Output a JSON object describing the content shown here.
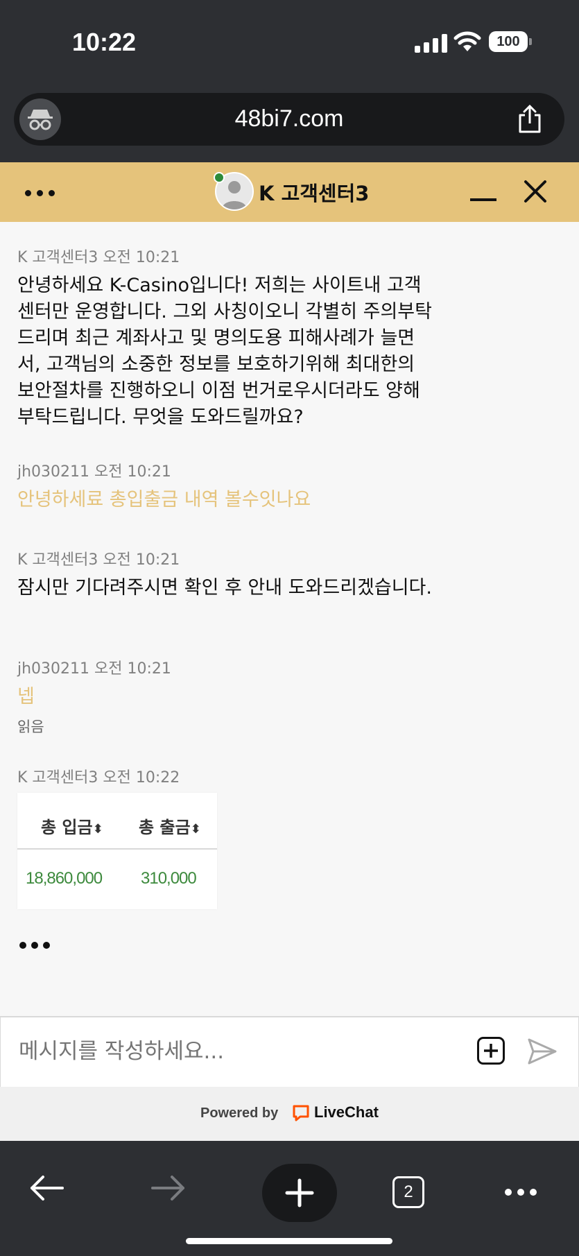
{
  "status_bar": {
    "time": "10:22",
    "battery": "100"
  },
  "browser": {
    "url": "48bi7.com",
    "tab_count": "2"
  },
  "chat_header": {
    "agent_name": "K 고객센터3"
  },
  "messages": [
    {
      "sender": "K 고객센터3",
      "time": "오전 10:21",
      "text": "안녕하세요 K-Casino입니다! 저희는 사이트내 고객센터만 운영합니다. 그외 사칭이오니 각별히 주의부탁드리며 최근 계좌사고 및 명의도용 피해사례가 늘면서, 고객님의 소중한 정보를 보호하기위해 최대한의 보안절차를 진행하오니 이점 번거로우시더라도 양해부탁드립니다. 무엇을 도와드릴까요?"
    },
    {
      "sender": "jh030211",
      "time": "오전 10:21",
      "text": "안녕하세료 총입출금 내역 볼수잇나요"
    },
    {
      "sender": "K 고객센터3",
      "time": "오전 10:21",
      "text": "잠시만 기다려주시면 확인 후 안내 도와드리겠습니다."
    },
    {
      "sender": "jh030211",
      "time": "오전 10:21",
      "text": "넵",
      "status": "읽음"
    },
    {
      "sender": "K 고객센터3",
      "time": "오전 10:22",
      "table": {
        "headers": [
          "총 입금",
          "총 출금"
        ],
        "sort_icon": "⬍",
        "values": [
          "18,860,000",
          "310,000"
        ]
      }
    }
  ],
  "composer": {
    "placeholder": "메시지를 작성하세요..."
  },
  "footer": {
    "powered_by": "Powered by",
    "brand": "LiveChat"
  },
  "colors": {
    "accent": "#e5c37b",
    "chrome_dark": "#2d2f33",
    "online": "#2e8b3a",
    "livechat": "#ff5100"
  }
}
